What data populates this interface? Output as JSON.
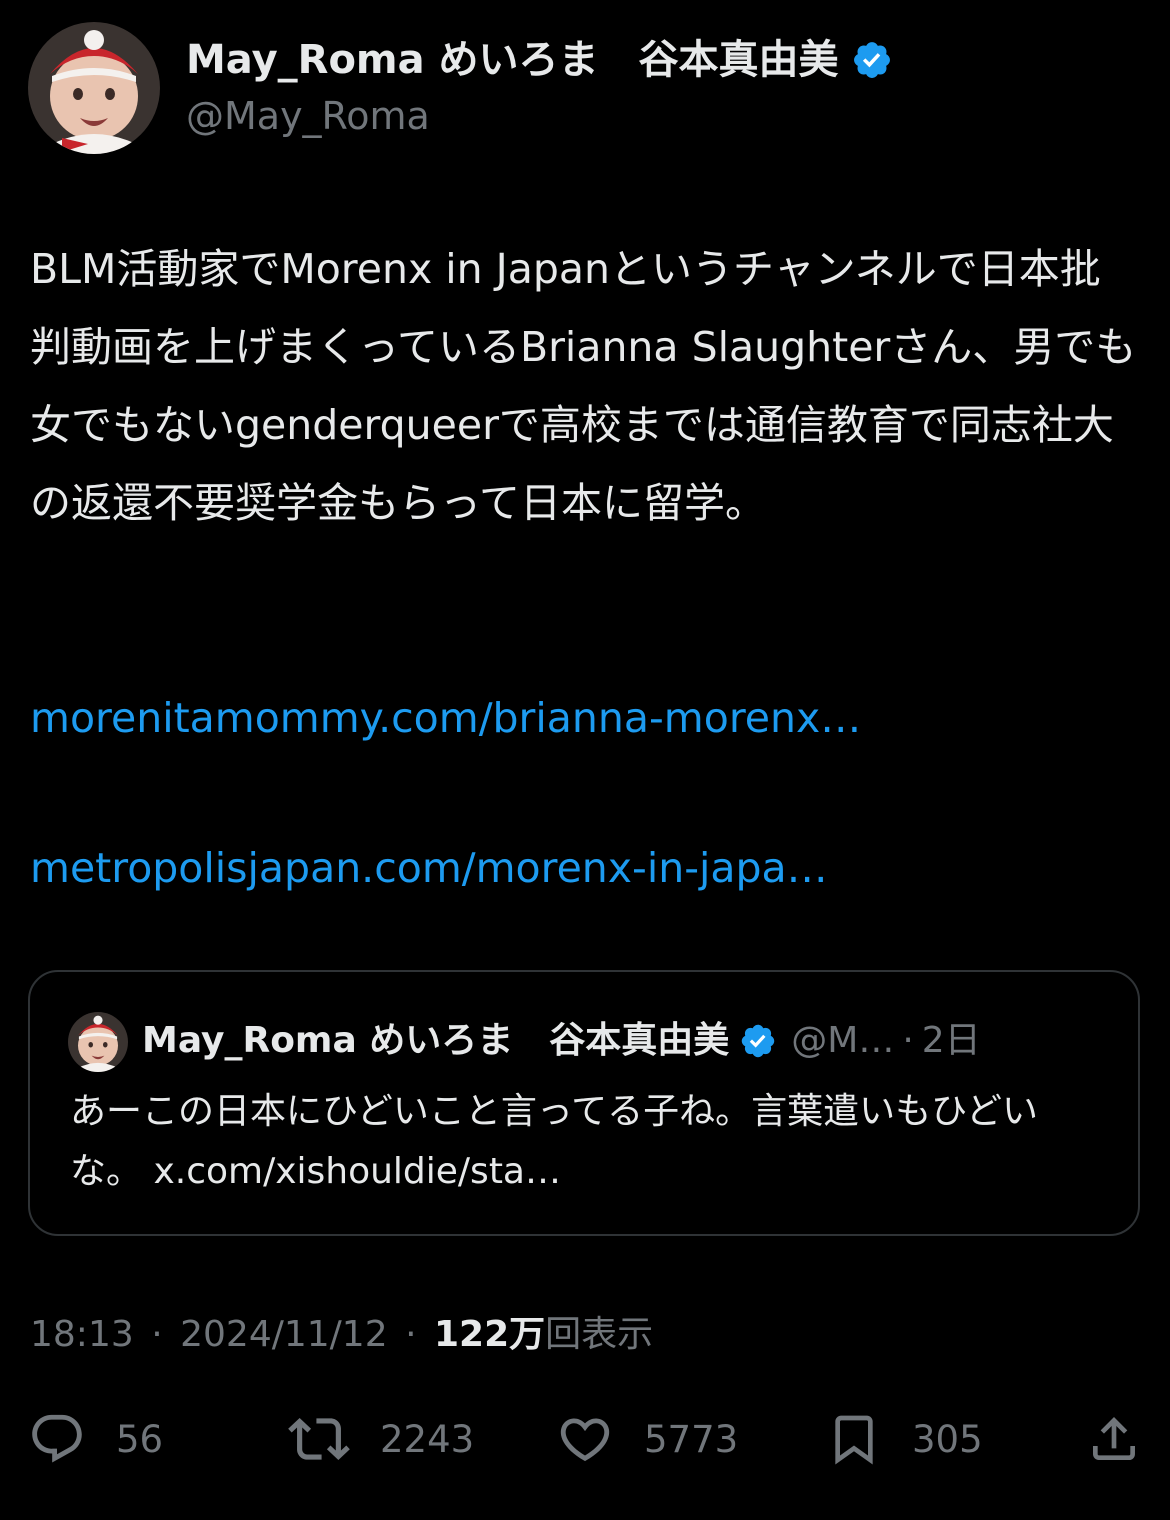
{
  "author": {
    "display_name": "May_Roma めいろま　谷本真由美",
    "handle": "@May_Roma",
    "verified": true,
    "verified_color": "#1d9bf0"
  },
  "tweet": {
    "text": "BLM活動家でMorenx in Japanというチャンネルで日本批判動画を上げまくっているBrianna Slaughterさん、男でも女でもないgenderqueerで高校までは通信教育で同志社大の返還不要奨学金もらって日本に留学。",
    "links": [
      "morenitamommy.com/brianna-morenx…",
      "metropolisjapan.com/morenx-in-japa…"
    ]
  },
  "quote": {
    "display_name": "May_Roma めいろま　谷本真由美",
    "handle_truncated": "@M…",
    "separator": "·",
    "age": "2日",
    "text": "あーこの日本にひどいこと言ってる子ね。言葉遣いもひどいな。 x.com/xishouldie/sta…"
  },
  "meta": {
    "time": "18:13",
    "separator": "·",
    "date": "2024/11/12",
    "views_count": "122万",
    "views_label": "回表示"
  },
  "actions": {
    "reply": {
      "icon": "reply-icon",
      "count": "56"
    },
    "retweet": {
      "icon": "retweet-icon",
      "count": "2243"
    },
    "like": {
      "icon": "heart-icon",
      "count": "5773"
    },
    "bookmark": {
      "icon": "bookmark-icon",
      "count": "305"
    },
    "share": {
      "icon": "share-icon"
    }
  },
  "colors": {
    "background": "#000000",
    "text": "#e7e9ea",
    "secondary": "#71767b",
    "link": "#1d9bf0",
    "border": "#2f3336"
  }
}
